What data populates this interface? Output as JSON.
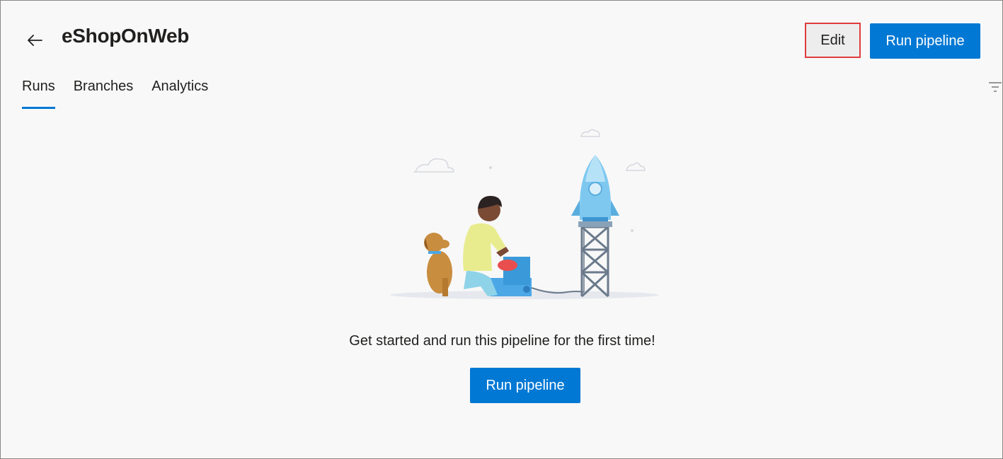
{
  "header": {
    "back_icon": "arrow-left-icon",
    "title": "eShopOnWeb",
    "edit_label": "Edit",
    "run_label": "Run pipeline"
  },
  "tabs": [
    {
      "label": "Runs",
      "active": true
    },
    {
      "label": "Branches",
      "active": false
    },
    {
      "label": "Analytics",
      "active": false
    }
  ],
  "toolbar": {
    "filter_icon": "filter-icon"
  },
  "empty_state": {
    "illustration": "rocket-launch-illustration",
    "message": "Get started and run this pipeline for the first time!",
    "run_label": "Run pipeline"
  },
  "colors": {
    "accent": "#0078d4",
    "highlight_border": "#e03c3c",
    "background": "#f8f8f8"
  }
}
